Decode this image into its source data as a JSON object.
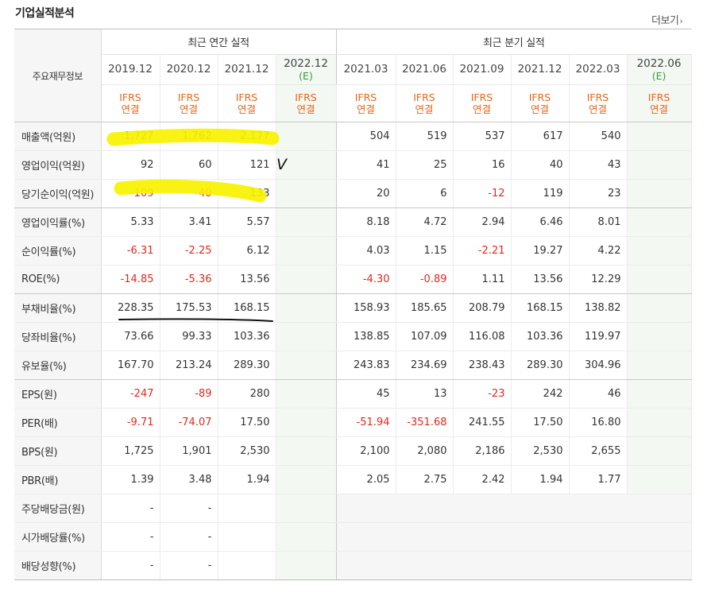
{
  "section": {
    "title": "기업실적분석",
    "more": "더보기"
  },
  "icons": {
    "more_arrow": "chevron-right-icon"
  },
  "table": {
    "corner_label": "주요재무정보",
    "groups": [
      {
        "label": "최근 연간 실적"
      },
      {
        "label": "최근 분기 실적"
      }
    ],
    "periods": [
      {
        "label": "2019.12",
        "est": ""
      },
      {
        "label": "2020.12",
        "est": ""
      },
      {
        "label": "2021.12",
        "est": ""
      },
      {
        "label": "2022.12",
        "est": "(E)"
      },
      {
        "label": "2021.03",
        "est": ""
      },
      {
        "label": "2021.06",
        "est": ""
      },
      {
        "label": "2021.09",
        "est": ""
      },
      {
        "label": "2021.12",
        "est": ""
      },
      {
        "label": "2022.03",
        "est": ""
      },
      {
        "label": "2022.06",
        "est": "(E)"
      }
    ],
    "acct_type": {
      "line1": "IFRS",
      "line2": "연결"
    },
    "rows": [
      {
        "label": "매출액(억원)",
        "annual": [
          "1,727",
          "1,762",
          "2,177",
          ""
        ],
        "quarter": [
          "504",
          "519",
          "537",
          "617",
          "540",
          ""
        ]
      },
      {
        "label": "영업이익(억원)",
        "annual": [
          "92",
          "60",
          "121",
          ""
        ],
        "quarter": [
          "41",
          "25",
          "16",
          "40",
          "43",
          ""
        ]
      },
      {
        "label": "당기순이익(억원)",
        "annual": [
          "-109",
          "-40",
          "133",
          ""
        ],
        "quarter": [
          "20",
          "6",
          "-12",
          "119",
          "23",
          ""
        ]
      },
      {
        "label": "영업이익률(%)",
        "annual": [
          "5.33",
          "3.41",
          "5.57",
          ""
        ],
        "quarter": [
          "8.18",
          "4.72",
          "2.94",
          "6.46",
          "8.01",
          ""
        ]
      },
      {
        "label": "순이익률(%)",
        "annual": [
          "-6.31",
          "-2.25",
          "6.12",
          ""
        ],
        "quarter": [
          "4.03",
          "1.15",
          "-2.21",
          "19.27",
          "4.22",
          ""
        ]
      },
      {
        "label": "ROE(%)",
        "annual": [
          "-14.85",
          "-5.36",
          "13.56",
          ""
        ],
        "quarter": [
          "-4.30",
          "-0.89",
          "1.11",
          "13.56",
          "12.29",
          ""
        ]
      },
      {
        "label": "부채비율(%)",
        "annual": [
          "228.35",
          "175.53",
          "168.15",
          ""
        ],
        "quarter": [
          "158.93",
          "185.65",
          "208.79",
          "168.15",
          "138.82",
          ""
        ]
      },
      {
        "label": "당좌비율(%)",
        "annual": [
          "73.66",
          "99.33",
          "103.36",
          ""
        ],
        "quarter": [
          "138.85",
          "107.09",
          "116.08",
          "103.36",
          "119.97",
          ""
        ]
      },
      {
        "label": "유보율(%)",
        "annual": [
          "167.70",
          "213.24",
          "289.30",
          ""
        ],
        "quarter": [
          "243.83",
          "234.69",
          "238.43",
          "289.30",
          "304.96",
          ""
        ]
      },
      {
        "label": "EPS(원)",
        "annual": [
          "-247",
          "-89",
          "280",
          ""
        ],
        "quarter": [
          "45",
          "13",
          "-23",
          "242",
          "46",
          ""
        ]
      },
      {
        "label": "PER(배)",
        "annual": [
          "-9.71",
          "-74.07",
          "17.50",
          ""
        ],
        "quarter": [
          "-51.94",
          "-351.68",
          "241.55",
          "17.50",
          "16.80",
          ""
        ]
      },
      {
        "label": "BPS(원)",
        "annual": [
          "1,725",
          "1,901",
          "2,530",
          ""
        ],
        "quarter": [
          "2,100",
          "2,080",
          "2,186",
          "2,530",
          "2,655",
          ""
        ]
      },
      {
        "label": "PBR(배)",
        "annual": [
          "1.39",
          "3.48",
          "1.94",
          ""
        ],
        "quarter": [
          "2.05",
          "2.75",
          "2.42",
          "1.94",
          "1.77",
          ""
        ]
      },
      {
        "label": "주당배당금(원)",
        "annual": [
          "-",
          "-",
          "",
          ""
        ],
        "quarter": []
      },
      {
        "label": "시가배당률(%)",
        "annual": [
          "-",
          "-",
          "",
          ""
        ],
        "quarter": []
      },
      {
        "label": "배당성향(%)",
        "annual": [
          "-",
          "-",
          "",
          ""
        ],
        "quarter": []
      }
    ]
  },
  "annotations": {
    "highlight_color": "#f9f200",
    "underline_color": "#111111",
    "checkmark": "V"
  }
}
